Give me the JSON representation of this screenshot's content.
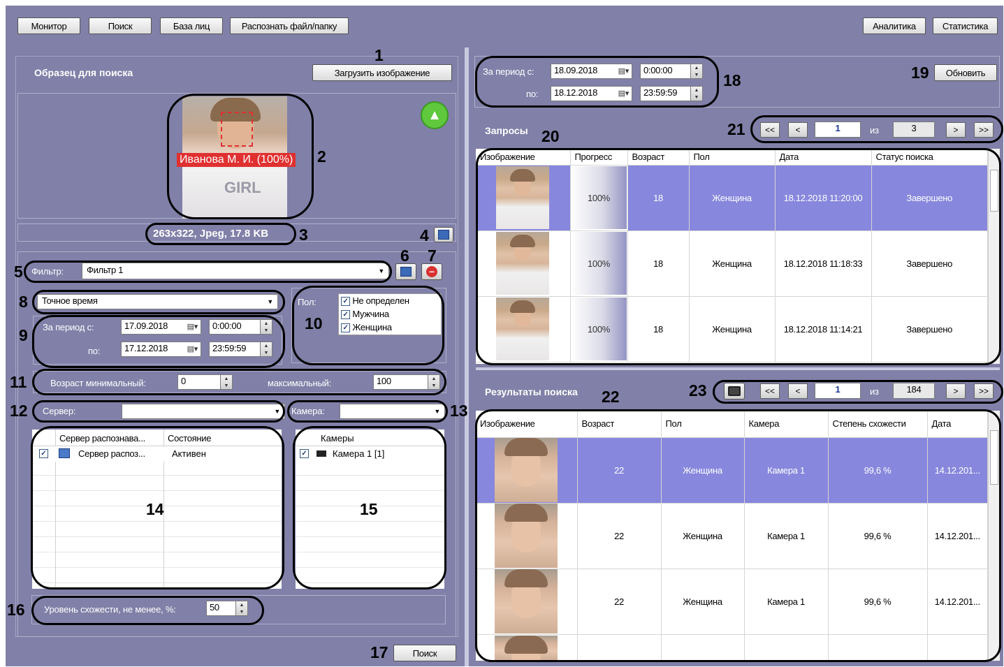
{
  "toolbar": {
    "monitor": "Монитор",
    "search": "Поиск",
    "face_db": "База лиц",
    "recognize": "Распознать файл/папку",
    "analytics": "Аналитика",
    "statistics": "Статистика"
  },
  "sample": {
    "title": "Образец для поиска",
    "load_button": "Загрузить изображение",
    "face_label": "Иванова М. И. (100%)",
    "image_info": "263x322, Jpeg, 17.8 KB",
    "shirt_text": "GIRL"
  },
  "filter": {
    "label": "Фильтр:",
    "value": "Фильтр 1",
    "time_mode": "Точное время",
    "period_from_label": "За период с:",
    "period_to_label": "по:",
    "date_from": "17.09.2018",
    "time_from": "0:00:00",
    "date_to": "17.12.2018",
    "time_to": "23:59:59",
    "gender_label": "Пол:",
    "gender_options": [
      {
        "label": "Не определен",
        "checked": true
      },
      {
        "label": "Мужчина",
        "checked": true
      },
      {
        "label": "Женщина",
        "checked": true
      }
    ],
    "age_min_label": "Возраст минимальный:",
    "age_min": "0",
    "age_max_label": "максимальный:",
    "age_max": "100",
    "server_label": "Сервер:",
    "camera_label": "Камера:",
    "server_table": {
      "headers": [
        "Сервер распознава...",
        "Состояние"
      ],
      "rows": [
        {
          "name": "Сервер распоз...",
          "state": "Активен"
        }
      ]
    },
    "camera_table": {
      "header": "Камеры",
      "rows": [
        {
          "name": "Камера 1 [1]"
        }
      ]
    },
    "similarity_label": "Уровень схожести, не менее, %:",
    "similarity": "50",
    "search_button": "Поиск"
  },
  "requests": {
    "period_from_label": "За период с:",
    "period_to_label": "по:",
    "date_from": "18.09.2018",
    "time_from": "0:00:00",
    "date_to": "18.12.2018",
    "time_to": "23:59:59",
    "refresh_button": "Обновить",
    "title": "Запросы",
    "pager": {
      "first": "<<",
      "prev": "<",
      "page": "1",
      "of": "из",
      "total": "3",
      "next": ">",
      "last": ">>"
    },
    "headers": [
      "Изображение",
      "Прогресс",
      "Возраст",
      "Пол",
      "Дата",
      "Статус поиска"
    ],
    "rows": [
      {
        "progress": "100%",
        "age": "18",
        "gender": "Женщина",
        "date": "18.12.2018 11:20:00",
        "status": "Завершено"
      },
      {
        "progress": "100%",
        "age": "18",
        "gender": "Женщина",
        "date": "18.12.2018 11:18:33",
        "status": "Завершено"
      },
      {
        "progress": "100%",
        "age": "18",
        "gender": "Женщина",
        "date": "18.12.2018 11:14:21",
        "status": "Завершено"
      }
    ]
  },
  "results": {
    "title": "Результаты поиска",
    "pager": {
      "first": "<<",
      "prev": "<",
      "page": "1",
      "of": "из",
      "total": "184",
      "next": ">",
      "last": ">>"
    },
    "headers": [
      "Изображение",
      "Возраст",
      "Пол",
      "Камера",
      "Степень схожести",
      "Дата"
    ],
    "rows": [
      {
        "age": "22",
        "gender": "Женщина",
        "camera": "Камера 1",
        "similarity": "99,6 %",
        "date": "14.12.201..."
      },
      {
        "age": "22",
        "gender": "Женщина",
        "camera": "Камера 1",
        "similarity": "99,6 %",
        "date": "14.12.201..."
      },
      {
        "age": "22",
        "gender": "Женщина",
        "camera": "Камера 1",
        "similarity": "99,6 %",
        "date": "14.12.201..."
      }
    ]
  },
  "annotations": [
    "1",
    "2",
    "3",
    "4",
    "5",
    "6",
    "7",
    "8",
    "9",
    "10",
    "11",
    "12",
    "13",
    "14",
    "15",
    "16",
    "17",
    "18",
    "19",
    "20",
    "21",
    "22",
    "23"
  ],
  "colors": {
    "background": "#8080a8",
    "selected_row": "#8787dd",
    "face_label_bg": "#e03030",
    "like_icon": "#5fc83c"
  }
}
